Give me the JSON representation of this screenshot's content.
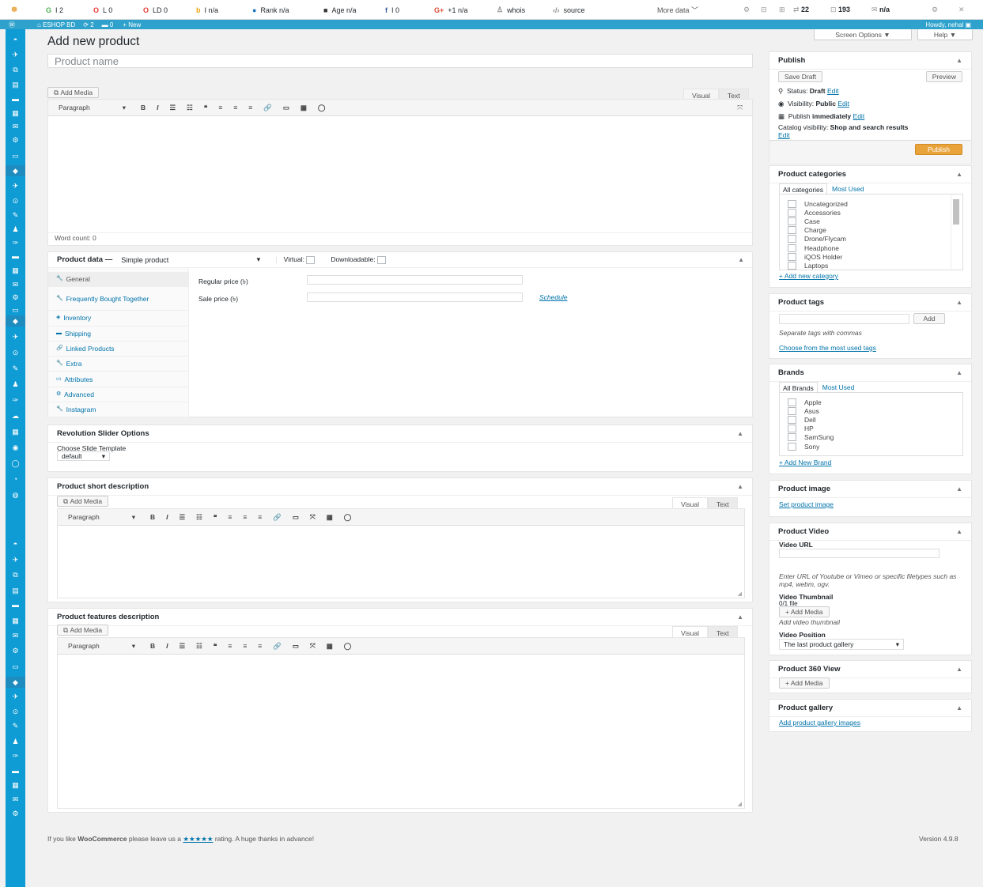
{
  "seobar": {
    "items": [
      {
        "icon": "G",
        "label": "I 2"
      },
      {
        "icon": "O",
        "label": "L 0"
      },
      {
        "icon": "O",
        "label": "LD 0"
      },
      {
        "icon": "b",
        "label": "I n/a"
      },
      {
        "icon": "●",
        "label": "Rank n/a"
      },
      {
        "icon": "■",
        "label": "Age n/a"
      },
      {
        "icon": "f",
        "label": "I 0"
      },
      {
        "icon": "G+",
        "label": "+1 n/a"
      },
      {
        "icon": "♙",
        "label": "whois"
      },
      {
        "icon": "‹/›",
        "label": "source"
      }
    ],
    "more_data": "More data",
    "right_items": [
      {
        "icon": "22",
        "label": ""
      },
      {
        "icon": "193",
        "label": ""
      },
      {
        "icon": "",
        "label": "n/a"
      }
    ],
    "colors": {
      "g": "#dd4b39",
      "o": "#e33",
      "b": "#f0a30a",
      "rank": "#1e73be",
      "fb": "#3b5998"
    }
  },
  "adminbar": {
    "site": "ESHOP BD",
    "updates": "2",
    "comments": "0",
    "new": "New",
    "howdy": "Howdy, nehal"
  },
  "screen_options": "Screen Options",
  "help": "Help",
  "page_title": "Add new product",
  "title_placeholder": "Product name",
  "editor": {
    "add_media": "Add Media",
    "visual": "Visual",
    "text": "Text",
    "paragraph": "Paragraph",
    "word_count": "Word count: 0"
  },
  "product_data": {
    "label": "Product data —",
    "type": "Simple product",
    "virtual": "Virtual:",
    "downloadable": "Downloadable:",
    "tabs": [
      {
        "icon": "🔧",
        "label": "General"
      },
      {
        "icon": "🔧",
        "label": "Frequently Bought Together"
      },
      {
        "icon": "◈",
        "label": "Inventory"
      },
      {
        "icon": "▬",
        "label": "Shipping"
      },
      {
        "icon": "🔗",
        "label": "Linked Products"
      },
      {
        "icon": "🔧",
        "label": "Extra"
      },
      {
        "icon": "▭",
        "label": "Attributes"
      },
      {
        "icon": "⚙",
        "label": "Advanced"
      },
      {
        "icon": "🔧",
        "label": "Instagram"
      }
    ],
    "regular_price": "Regular price (৳)",
    "sale_price": "Sale price (৳)",
    "schedule": "Schedule"
  },
  "revslider": {
    "title": "Revolution Slider Options",
    "label": "Choose Slide Template",
    "value": "default"
  },
  "short_desc": {
    "title": "Product short description"
  },
  "features_desc": {
    "title": "Product features description"
  },
  "footer": {
    "prefix": "If you like ",
    "brand": "WooCommerce",
    "mid": " please leave us a ",
    "stars": "★★★★★",
    "suffix": " rating. A huge thanks in advance!",
    "version": "Version 4.9.8"
  },
  "publish": {
    "title": "Publish",
    "save_draft": "Save Draft",
    "preview": "Preview",
    "status_label": "Status: ",
    "status_value": "Draft",
    "visibility_label": "Visibility: ",
    "visibility_value": "Public",
    "publish_label": "Publish ",
    "publish_value": "immediately",
    "edit": "Edit",
    "catalog_label": "Catalog visibility: ",
    "catalog_value": "Shop and search results",
    "publish_btn": "Publish"
  },
  "categories": {
    "title": "Product categories",
    "tab_all": "All categories",
    "tab_most": "Most Used",
    "items": [
      "Uncategorized",
      "Accessories",
      "Case",
      "Charge",
      "Drone/Flycam",
      "Headphone",
      "iQOS Holder",
      "Laptops"
    ],
    "add_new": "+ Add new category"
  },
  "tags": {
    "title": "Product tags",
    "add": "Add",
    "hint": "Separate tags with commas",
    "choose": "Choose from the most used tags"
  },
  "brands": {
    "title": "Brands",
    "tab_all": "All Brands",
    "tab_most": "Most Used",
    "items": [
      "Apple",
      "Asus",
      "Dell",
      "HP",
      "SamSung",
      "Sony"
    ],
    "add_new": "+ Add New Brand"
  },
  "product_image": {
    "title": "Product image",
    "link": "Set product image"
  },
  "video": {
    "title": "Product Video",
    "url_label": "Video URL",
    "hint": "Enter URL of Youtube or Vimeo or specific filetypes such as mp4, webm, ogv.",
    "thumb_label": "Video Thumbnail",
    "thumb_count": "0/1 file",
    "add_media": "+ Add Media",
    "thumb_hint": "Add video thumbnail",
    "position_label": "Video Position",
    "position_value": "The last product gallery"
  },
  "view360": {
    "title": "Product 360 View",
    "add_media": "+ Add Media"
  },
  "gallery": {
    "title": "Product gallery",
    "link": "Add product gallery images"
  }
}
